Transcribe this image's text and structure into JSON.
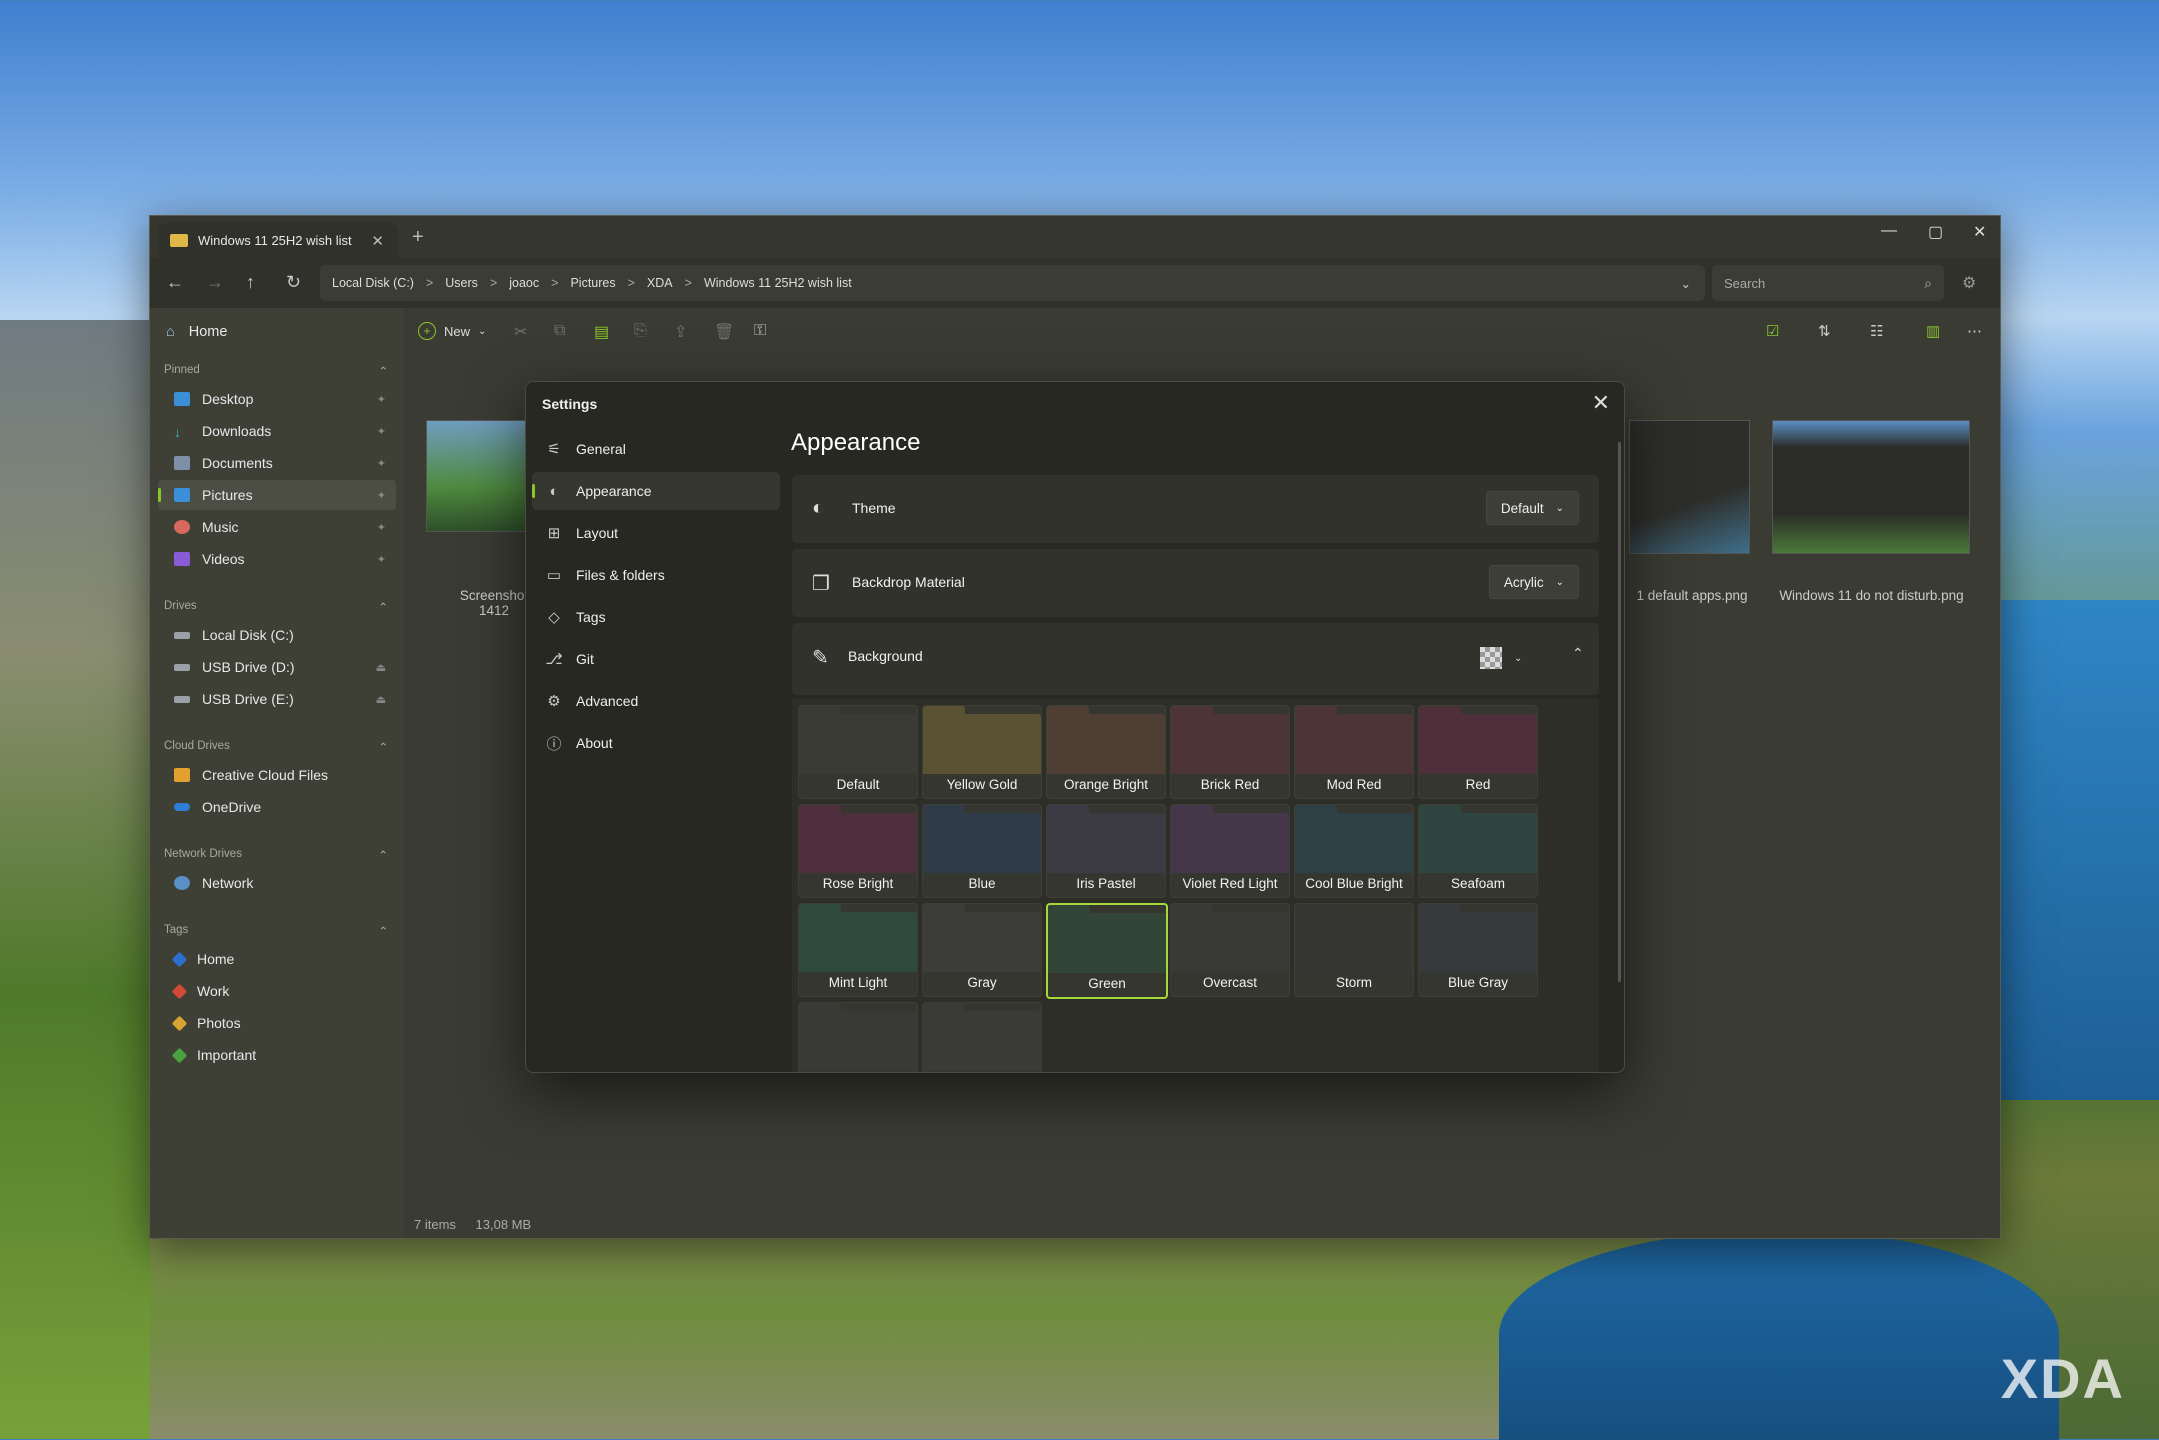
{
  "window": {
    "tab_title": "Windows 11 25H2 wish list",
    "close_glyph": "✕",
    "new_tab_glyph": "+",
    "controls": {
      "minimize": "—",
      "maximize": "▢",
      "close": "✕"
    }
  },
  "nav": {
    "back": "←",
    "forward": "→",
    "up": "↑",
    "refresh": "↻",
    "breadcrumb": [
      "Local Disk (C:)",
      "Users",
      "joaoc",
      "Pictures",
      "XDA",
      "Windows 11 25H2 wish list"
    ],
    "crumb_sep": ">",
    "dropdown": "⌄",
    "search_placeholder": "Search",
    "search_icon": "⌕"
  },
  "sidebar": {
    "home": "Home",
    "sections": {
      "pinned": "Pinned",
      "drives": "Drives",
      "cloud": "Cloud Drives",
      "network": "Network Drives",
      "tags": "Tags"
    },
    "pinned": [
      "Desktop",
      "Downloads",
      "Documents",
      "Pictures",
      "Music",
      "Videos"
    ],
    "drives": [
      "Local Disk (C:)",
      "USB Drive (D:)",
      "USB Drive (E:)"
    ],
    "cloud": [
      "Creative Cloud Files",
      "OneDrive"
    ],
    "network": [
      "Network"
    ],
    "tags": [
      "Home",
      "Work",
      "Photos",
      "Important"
    ],
    "caret": "⌃"
  },
  "toolbar": {
    "new_label": "New"
  },
  "files": {
    "left_label_1": "Screenshot",
    "left_label_2": "1412",
    "right_label_1": "1 default apps.png",
    "right_label_2": "Windows 11 do not disturb.png"
  },
  "status": {
    "items": "7 items",
    "size": "13,08 MB"
  },
  "settings": {
    "title": "Settings",
    "close": "✕",
    "nav": [
      "General",
      "Appearance",
      "Layout",
      "Files & folders",
      "Tags",
      "Git",
      "Advanced",
      "About"
    ],
    "page_title": "Appearance",
    "theme_label": "Theme",
    "theme_value": "Default",
    "backdrop_label": "Backdrop Material",
    "backdrop_value": "Acrylic",
    "background_label": "Background",
    "swatches": [
      {
        "name": "Default",
        "color": "#3a3b35"
      },
      {
        "name": "Yellow Gold",
        "color": "#5a5233"
      },
      {
        "name": "Orange Bright",
        "color": "#4f3e34"
      },
      {
        "name": "Brick Red",
        "color": "#4d3536"
      },
      {
        "name": "Mod Red",
        "color": "#4d3436"
      },
      {
        "name": "Red",
        "color": "#4f2f3a"
      },
      {
        "name": "Rose Bright",
        "color": "#4f2f3d"
      },
      {
        "name": "Blue",
        "color": "#2f3b47"
      },
      {
        "name": "Iris Pastel",
        "color": "#3c3a42"
      },
      {
        "name": "Violet Red Light",
        "color": "#45364a"
      },
      {
        "name": "Cool Blue Bright",
        "color": "#2f4044"
      },
      {
        "name": "Seafoam",
        "color": "#2f4640"
      },
      {
        "name": "Mint Light",
        "color": "#2e4a3f"
      },
      {
        "name": "Gray",
        "color": "#3c3d38"
      },
      {
        "name": "Green",
        "color": "#334536"
      },
      {
        "name": "Overcast",
        "color": "#393a36"
      },
      {
        "name": "Storm",
        "color": "#363733"
      },
      {
        "name": "Blue Gray",
        "color": "#363a3c"
      },
      {
        "name": "",
        "color": "#393a35"
      },
      {
        "name": "",
        "color": "#3a3b36"
      }
    ],
    "selected_swatch": "Green"
  },
  "watermark": "XDA",
  "colors": {
    "accent": "#8ac52a"
  }
}
